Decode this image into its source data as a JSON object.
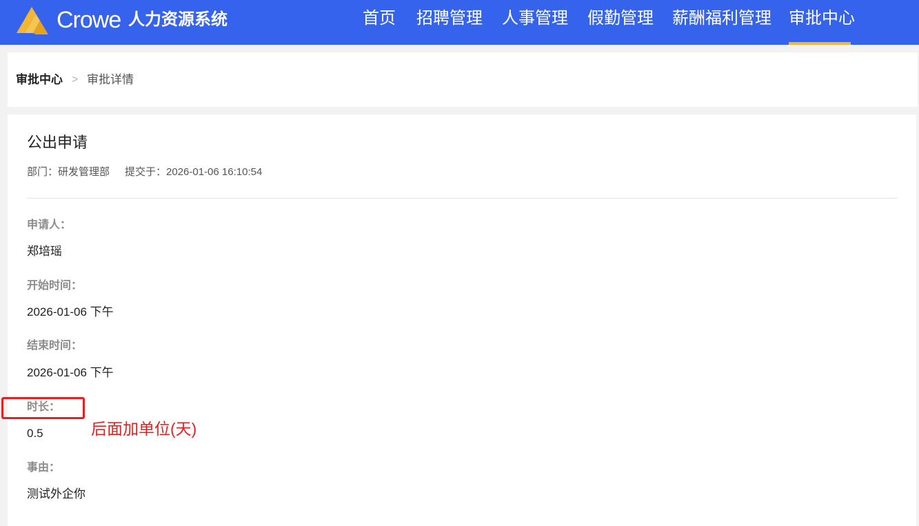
{
  "header": {
    "brand": "Crowe",
    "system_name": "人力资源系统",
    "nav": [
      {
        "label": "首页"
      },
      {
        "label": "招聘管理"
      },
      {
        "label": "人事管理"
      },
      {
        "label": "假勤管理"
      },
      {
        "label": "薪酬福利管理"
      },
      {
        "label": "审批中心",
        "active": true
      }
    ],
    "accent_color": "#f2b632",
    "bar_color": "#3563ec"
  },
  "breadcrumb": {
    "root": "审批中心",
    "separator": ">",
    "current": "审批详情"
  },
  "detail": {
    "title": "公出申请",
    "department": "部门：研发管理部",
    "submitted": "提交于：2026-01-06 16:10:54",
    "fields": [
      {
        "label": "申请人：",
        "value": "郑培瑶"
      },
      {
        "label": "开始时间：",
        "value": "2026-01-06 下午"
      },
      {
        "label": "结束时间：",
        "value": "2026-01-06 下午"
      },
      {
        "label": "时长：",
        "value": "0.5"
      },
      {
        "label": "事由：",
        "value": "测试外企你"
      }
    ]
  },
  "annotation": {
    "text": "后面加单位(天)",
    "color": "#ee1d1d"
  }
}
